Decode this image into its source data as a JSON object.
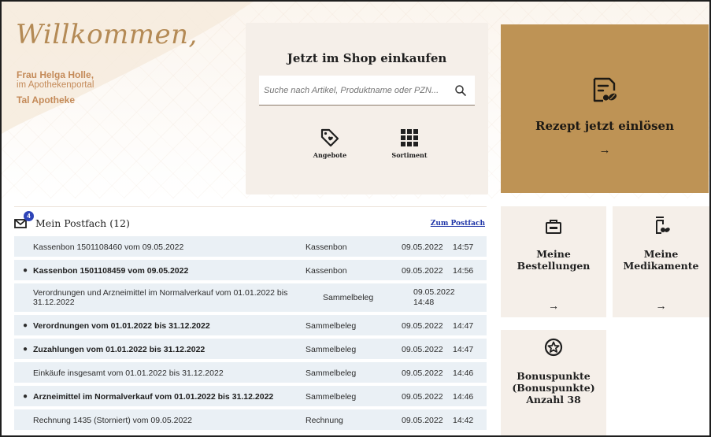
{
  "welcome": {
    "title": "Willkommen,",
    "name": "Frau Helga Holle,",
    "portal": "im Apothekenportal",
    "pharmacy": "Tal Apotheke"
  },
  "shop": {
    "title": "Jetzt im Shop einkaufen",
    "search_placeholder": "Suche nach Artikel, Produktname oder PZN...",
    "offers_label": "Angebote",
    "assortment_label": "Sortiment"
  },
  "prescription": {
    "title": "Rezept jetzt einlösen",
    "arrow": "→"
  },
  "tiles": {
    "orders": {
      "line1": "Meine",
      "line2": "Bestellungen",
      "arrow": "→"
    },
    "medications": {
      "line1": "Meine",
      "line2": "Medikamente",
      "arrow": "→"
    },
    "bonus": {
      "line1": "Bonuspunkte",
      "line2": "(Bonuspunkte)",
      "line3": "Anzahl 38"
    }
  },
  "mailbox": {
    "title": "Mein Postfach (12)",
    "badge": "4",
    "link": "Zum Postfach",
    "messages": [
      {
        "subject": "Kassenbon 1501108460 vom 09.05.2022",
        "type": "Kassenbon",
        "date": "09.05.2022",
        "time": "14:57",
        "unread": false
      },
      {
        "subject": "Kassenbon 1501108459 vom 09.05.2022",
        "type": "Kassenbon",
        "date": "09.05.2022",
        "time": "14:56",
        "unread": true
      },
      {
        "subject": "Verordnungen und Arzneimittel im Normalverkauf vom 01.01.2022 bis 31.12.2022",
        "type": "Sammelbeleg",
        "date": "09.05.2022",
        "time": "14:48",
        "unread": false
      },
      {
        "subject": "Verordnungen vom 01.01.2022 bis 31.12.2022",
        "type": "Sammelbeleg",
        "date": "09.05.2022",
        "time": "14:47",
        "unread": true
      },
      {
        "subject": "Zuzahlungen vom 01.01.2022 bis 31.12.2022",
        "type": "Sammelbeleg",
        "date": "09.05.2022",
        "time": "14:47",
        "unread": true
      },
      {
        "subject": "Einkäufe insgesamt vom 01.01.2022 bis 31.12.2022",
        "type": "Sammelbeleg",
        "date": "09.05.2022",
        "time": "14:46",
        "unread": false
      },
      {
        "subject": "Arzneimittel im Normalverkauf vom 01.01.2022 bis 31.12.2022",
        "type": "Sammelbeleg",
        "date": "09.05.2022",
        "time": "14:46",
        "unread": true
      },
      {
        "subject": "Rechnung 1435 (Storniert) vom 09.05.2022",
        "type": "Rechnung",
        "date": "09.05.2022",
        "time": "14:42",
        "unread": false
      }
    ]
  },
  "colors": {
    "gold": "#be9355",
    "beige": "#f5efe9",
    "row": "#eaf0f5",
    "accent_text": "#c48a58",
    "link": "#2036a8"
  }
}
